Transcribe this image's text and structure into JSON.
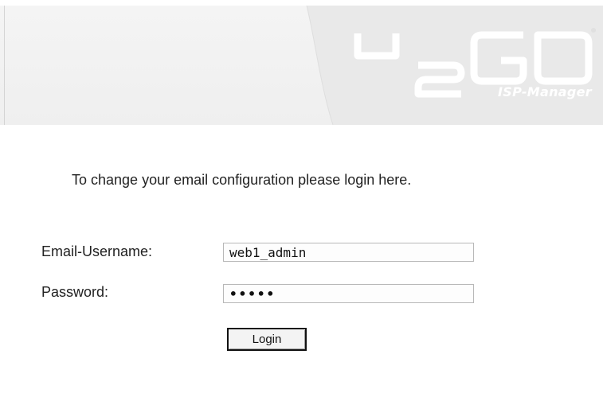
{
  "header": {
    "logo_text": "4 2 GO",
    "logo_caption": "ISP-Manager"
  },
  "intro": {
    "text": "To change your email configuration please login here."
  },
  "form": {
    "username_label": "Email-Username:",
    "username_value": "web1_admin",
    "password_label": "Password:",
    "password_value": "•••••",
    "login_label": "Login"
  },
  "colors": {
    "header_bg": "#f1f1f1",
    "logo_color": "#e7e7e7",
    "text": "#222222"
  },
  "icons": {
    "logo": "42go-logo"
  }
}
